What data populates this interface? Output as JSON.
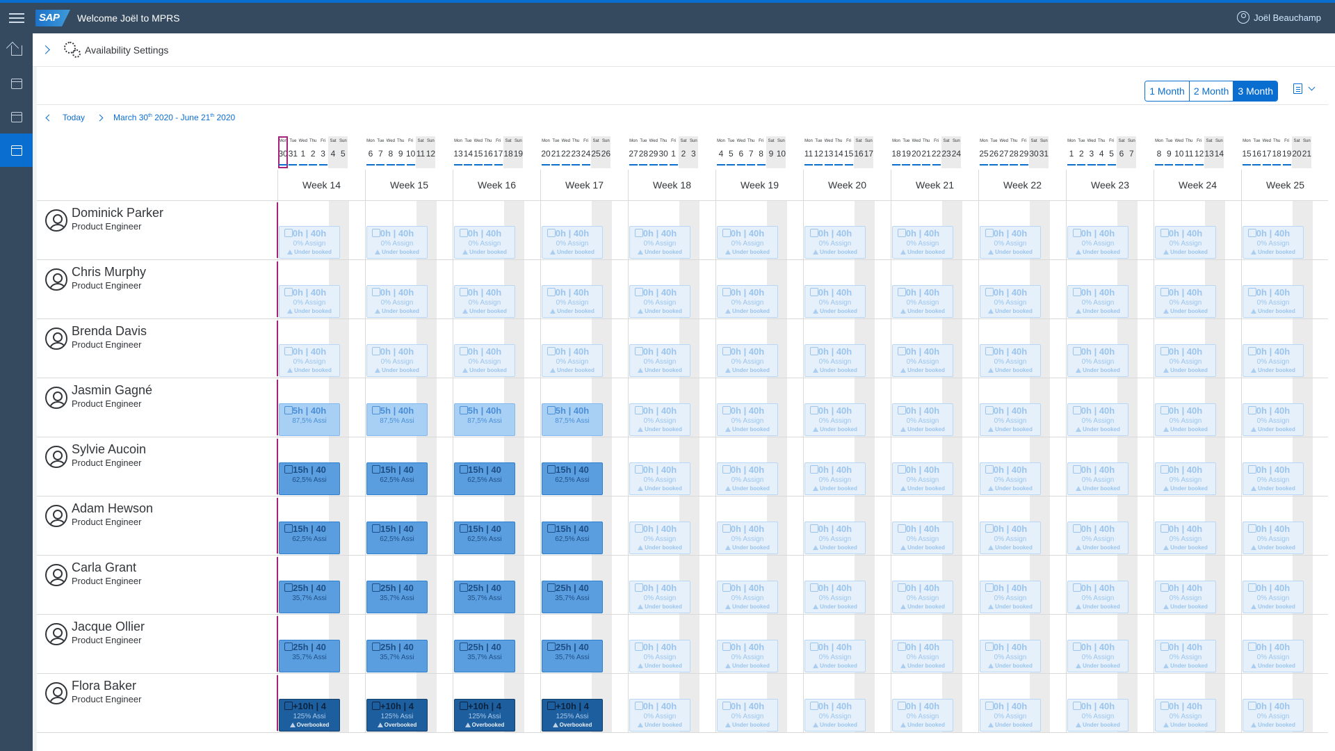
{
  "shell": {
    "logo": "SAP",
    "welcome": "Welcome Joël to MPRS",
    "user": "Joël Beauchamp"
  },
  "nav": [
    "home-icon",
    "task-calendar-icon",
    "calendar-icon",
    "availability-calendar-icon"
  ],
  "page": {
    "title": "Availability Settings"
  },
  "toolbar": {
    "ranges": [
      {
        "label": "1 Month",
        "selected": false
      },
      {
        "label": "2 Month",
        "selected": false
      },
      {
        "label": "3 Month",
        "selected": true
      }
    ],
    "today_label": "Today",
    "range": {
      "start": "March 30",
      "start_sup": "th",
      "mid": " 2020 - June 21",
      "end_sup": "th",
      "end": " 2020"
    }
  },
  "days": [
    [
      "Mon",
      "30"
    ],
    [
      "Tue",
      "31"
    ],
    [
      "Wed",
      "1"
    ],
    [
      "Thu",
      "2"
    ],
    [
      "Fri",
      "3"
    ],
    [
      "Sat",
      "4"
    ],
    [
      "Sun",
      "5"
    ],
    [
      "Mon",
      "6"
    ],
    [
      "Tue",
      "7"
    ],
    [
      "Wed",
      "8"
    ],
    [
      "Thu",
      "9"
    ],
    [
      "Fri",
      "10"
    ],
    [
      "Sat",
      "11"
    ],
    [
      "Sun",
      "12"
    ],
    [
      "Mon",
      "13"
    ],
    [
      "Tue",
      "14"
    ],
    [
      "Wed",
      "15"
    ],
    [
      "Thu",
      "16"
    ],
    [
      "Fri",
      "17"
    ],
    [
      "Sat",
      "18"
    ],
    [
      "Sun",
      "19"
    ],
    [
      "Mon",
      "20"
    ],
    [
      "Tue",
      "21"
    ],
    [
      "Wed",
      "22"
    ],
    [
      "Thu",
      "23"
    ],
    [
      "Fri",
      "24"
    ],
    [
      "Sat",
      "25"
    ],
    [
      "Sun",
      "26"
    ],
    [
      "Mon",
      "27"
    ],
    [
      "Tue",
      "28"
    ],
    [
      "Wed",
      "29"
    ],
    [
      "Thu",
      "30"
    ],
    [
      "Fri",
      "1"
    ],
    [
      "Sat",
      "2"
    ],
    [
      "Sun",
      "3"
    ],
    [
      "Mon",
      "4"
    ],
    [
      "Tue",
      "5"
    ],
    [
      "Wed",
      "6"
    ],
    [
      "Thu",
      "7"
    ],
    [
      "Fri",
      "8"
    ],
    [
      "Sat",
      "9"
    ],
    [
      "Sun",
      "10"
    ],
    [
      "Mon",
      "11"
    ],
    [
      "Tue",
      "12"
    ],
    [
      "Wed",
      "13"
    ],
    [
      "Thu",
      "14"
    ],
    [
      "Fri",
      "15"
    ],
    [
      "Sat",
      "16"
    ],
    [
      "Sun",
      "17"
    ],
    [
      "Mon",
      "18"
    ],
    [
      "Tue",
      "19"
    ],
    [
      "Wed",
      "20"
    ],
    [
      "Thu",
      "21"
    ],
    [
      "Fri",
      "22"
    ],
    [
      "Sat",
      "23"
    ],
    [
      "Sun",
      "24"
    ],
    [
      "Mon",
      "25"
    ],
    [
      "Tue",
      "26"
    ],
    [
      "Wed",
      "27"
    ],
    [
      "Thu",
      "28"
    ],
    [
      "Fri",
      "29"
    ],
    [
      "Sat",
      "30"
    ],
    [
      "Sun",
      "31"
    ],
    [
      "Mon",
      "1"
    ],
    [
      "Tue",
      "2"
    ],
    [
      "Wed",
      "3"
    ],
    [
      "Thu",
      "4"
    ],
    [
      "Fri",
      "5"
    ],
    [
      "Sat",
      "6"
    ],
    [
      "Sun",
      "7"
    ],
    [
      "Mon",
      "8"
    ],
    [
      "Tue",
      "9"
    ],
    [
      "Wed",
      "10"
    ],
    [
      "Thu",
      "11"
    ],
    [
      "Fri",
      "12"
    ],
    [
      "Sat",
      "13"
    ],
    [
      "Sun",
      "14"
    ],
    [
      "Mon",
      "15"
    ],
    [
      "Tue",
      "16"
    ],
    [
      "Wed",
      "17"
    ],
    [
      "Thu",
      "18"
    ],
    [
      "Fri",
      "19"
    ],
    [
      "Sat",
      "20"
    ],
    [
      "Sun",
      "21"
    ]
  ],
  "weeks": [
    "Week 14",
    "Week 15",
    "Week 16",
    "Week 17",
    "Week 18",
    "Week 19",
    "Week 20",
    "Week 21",
    "Week 22",
    "Week 23",
    "Week 24",
    "Week 25"
  ],
  "card_types": {
    "under": {
      "hrs": "0h | 40h",
      "pct": "0% Assign",
      "status": "Under booked"
    },
    "light": {
      "hrs": "5h | 40h",
      "pct": "87,5% Assi",
      "status": ""
    },
    "mid15": {
      "hrs": "15h | 40",
      "pct": "62,5% Assi",
      "status": ""
    },
    "mid25": {
      "hrs": "25h | 40",
      "pct": "35,7% Assi",
      "status": ""
    },
    "over": {
      "hrs": "+10h | 4",
      "pct": "125% Assi",
      "status": "Overbooked"
    }
  },
  "people": [
    {
      "name": "Dominick Parker",
      "role": "Product Engineer",
      "first4": "under"
    },
    {
      "name": "Chris Murphy",
      "role": "Product Engineer",
      "first4": "under"
    },
    {
      "name": "Brenda Davis",
      "role": "Product Engineer",
      "first4": "under"
    },
    {
      "name": "Jasmin Gagné",
      "role": "Product Engineer",
      "first4": "light"
    },
    {
      "name": "Sylvie Aucoin",
      "role": "Product Engineer",
      "first4": "mid15"
    },
    {
      "name": "Adam Hewson",
      "role": "Product Engineer",
      "first4": "mid15"
    },
    {
      "name": "Carla Grant",
      "role": "Product Engineer",
      "first4": "mid25"
    },
    {
      "name": "Jacque Ollier",
      "role": "Product Engineer",
      "first4": "mid25"
    },
    {
      "name": "Flora Baker",
      "role": "Product Engineer",
      "first4": "over"
    }
  ]
}
